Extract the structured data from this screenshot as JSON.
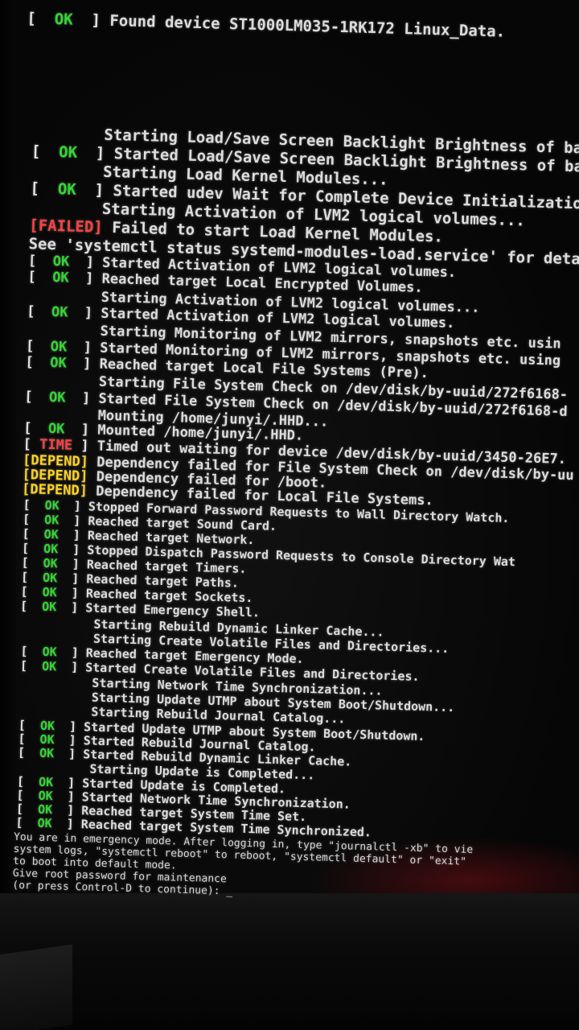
{
  "status_labels": {
    "ok": "OK",
    "failed": "FAILED",
    "time": "TIME",
    "depend": "DEPEND"
  },
  "lines": [
    {
      "status": "ok",
      "text": "Found device ST1000LM035-1RK172 Linux_Data."
    },
    {
      "status": "",
      "text": "Starting Load/Save Screen Backlight Brightness of back"
    },
    {
      "status": "ok",
      "text": "Started Load/Save Screen Backlight Brightness of backl"
    },
    {
      "status": "",
      "text": "Starting Load Kernel Modules..."
    },
    {
      "status": "ok",
      "text": "Started udev Wait for Complete Device Initialization."
    },
    {
      "status": "",
      "text": "Starting Activation of LVM2 logical volumes..."
    },
    {
      "status": "failed",
      "text": "Failed to start Load Kernel Modules."
    },
    {
      "status": "",
      "text": "See 'systemctl status systemd-modules-load.service' for details."
    },
    {
      "status": "ok",
      "text": "Started Activation of LVM2 logical volumes."
    },
    {
      "status": "ok",
      "text": "Reached target Local Encrypted Volumes."
    },
    {
      "status": "",
      "text": "Starting Activation of LVM2 logical volumes..."
    },
    {
      "status": "ok",
      "text": "Started Activation of LVM2 logical volumes."
    },
    {
      "status": "",
      "text": "Starting Monitoring of LVM2 mirrors, snapshots etc. usin"
    },
    {
      "status": "ok",
      "text": "Started Monitoring of LVM2 mirrors, snapshots etc. using"
    },
    {
      "status": "ok",
      "text": "Reached target Local File Systems (Pre)."
    },
    {
      "status": "",
      "text": "Starting File System Check on /dev/disk/by-uuid/272f6168-"
    },
    {
      "status": "ok",
      "text": "Started File System Check on /dev/disk/by-uuid/272f6168-d"
    },
    {
      "status": "",
      "text": "Mounting /home/junyi/.HHD..."
    },
    {
      "status": "ok",
      "text": "Mounted /home/junyi/.HHD."
    },
    {
      "status": "time",
      "text": "Timed out waiting for device /dev/disk/by-uuid/3450-26E7."
    },
    {
      "status": "depend",
      "text": "Dependency failed for File System Check on /dev/disk/by-uu"
    },
    {
      "status": "depend",
      "text": "Dependency failed for /boot."
    },
    {
      "status": "depend",
      "text": "Dependency failed for Local File Systems."
    },
    {
      "status": "ok",
      "text": "Stopped Forward Password Requests to Wall Directory Watch."
    },
    {
      "status": "ok",
      "text": "Reached target Sound Card."
    },
    {
      "status": "ok",
      "text": "Reached target Network."
    },
    {
      "status": "ok",
      "text": "Stopped Dispatch Password Requests to Console Directory Wat"
    },
    {
      "status": "ok",
      "text": "Reached target Timers."
    },
    {
      "status": "ok",
      "text": "Reached target Paths."
    },
    {
      "status": "ok",
      "text": "Reached target Sockets."
    },
    {
      "status": "ok",
      "text": "Started Emergency Shell."
    },
    {
      "status": "",
      "text": "Starting Rebuild Dynamic Linker Cache..."
    },
    {
      "status": "",
      "text": "Starting Create Volatile Files and Directories..."
    },
    {
      "status": "ok",
      "text": "Reached target Emergency Mode."
    },
    {
      "status": "ok",
      "text": "Started Create Volatile Files and Directories."
    },
    {
      "status": "",
      "text": "Starting Network Time Synchronization..."
    },
    {
      "status": "",
      "text": "Starting Update UTMP about System Boot/Shutdown..."
    },
    {
      "status": "",
      "text": "Starting Rebuild Journal Catalog..."
    },
    {
      "status": "ok",
      "text": "Started Update UTMP about System Boot/Shutdown."
    },
    {
      "status": "ok",
      "text": "Started Rebuild Journal Catalog."
    },
    {
      "status": "ok",
      "text": "Started Rebuild Dynamic Linker Cache."
    },
    {
      "status": "",
      "text": "Starting Update is Completed..."
    },
    {
      "status": "ok",
      "text": "Started Update is Completed."
    },
    {
      "status": "ok",
      "text": "Started Network Time Synchronization."
    },
    {
      "status": "ok",
      "text": "Reached target System Time Set."
    },
    {
      "status": "ok",
      "text": "Reached target System Time Synchronized."
    }
  ],
  "emergency": [
    "You are in emergency mode. After logging in, type \"journalctl -xb\" to vie",
    "system logs, \"systemctl reboot\" to reboot, \"systemctl default\" or \"exit\"",
    "to boot into default mode.",
    "Give root password for maintenance",
    "(or press Control-D to continue): "
  ],
  "cursor": "_"
}
